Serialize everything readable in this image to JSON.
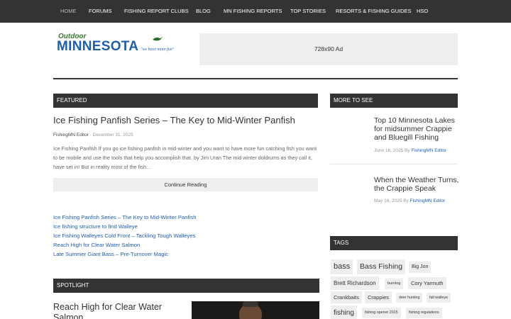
{
  "nav": {
    "items": [
      {
        "label": "HOME"
      },
      {
        "label": "FORUMS"
      },
      {
        "label": "FISHING REPORT CLUBS"
      },
      {
        "label": "BLOG"
      },
      {
        "label": "MN FISHING REPORTS"
      },
      {
        "label": "TOP STORIES"
      },
      {
        "label": "RESORTS & FISHING GUIDES"
      },
      {
        "label": "HSO"
      }
    ]
  },
  "header": {
    "logo_line1": "Outdoor",
    "logo_line2": "MINNESOTA",
    "logo_tagline": "\"we have more fun\"",
    "ad_label": "728x90 Ad"
  },
  "featured": {
    "section_label": "FEATURED",
    "title": "Ice Fishing Panfish Series – The Key to Mid-Winter Panfish",
    "author": "FishingMN Editor",
    "date": "December 31, 2025",
    "excerpt": "Ice Fishing Panfish If you go ice fishing panfish in mid-winter and you want to have more fun catching fish you want to be mobile and use the tools that help you accomplish that. by Jim Uran The mid winter doldrums as they call it, have set in! But in reality most of the fish…",
    "continue_label": "Continue Reading",
    "more_links": [
      "Ice Fishing Panfish Series – The Key to Mid-Winter Panfish",
      "Ice fishing structure to find Walleye",
      "Ice Fishing Walleyes Cold Front – Tackling Tough Walleyes",
      "Reach High for Clear Water Salmon",
      "Late Summer Giant Bass – Pre-Turnover Magic"
    ]
  },
  "spotlight": {
    "section_label": "SPOTLIGHT",
    "title": "Reach High for Clear Water Salmon"
  },
  "sidebar": {
    "more_label": "MORE TO SEE",
    "posts": [
      {
        "title": "Top 10 Minnesota Lakes for midsummer Crappie and Bluegill Fishing",
        "date": "June 16, 2025",
        "by": "By",
        "author": "FishingMN Editor"
      },
      {
        "title": "When the Weather Turns, the Crappie Speak",
        "date": "May 16, 2025",
        "by": "By",
        "author": "FishingMN Editor"
      }
    ],
    "tags_label": "TAGS",
    "tags": [
      "bass",
      "Bass Fishing",
      "Big Jon",
      "Brett Richardson",
      "burning",
      "Cory Yarmuth",
      "Crankbaits",
      "Crappies",
      "deer hunting",
      "fall walleye",
      "fishing",
      "fishing opener 2015",
      "fishing regulations"
    ]
  }
}
